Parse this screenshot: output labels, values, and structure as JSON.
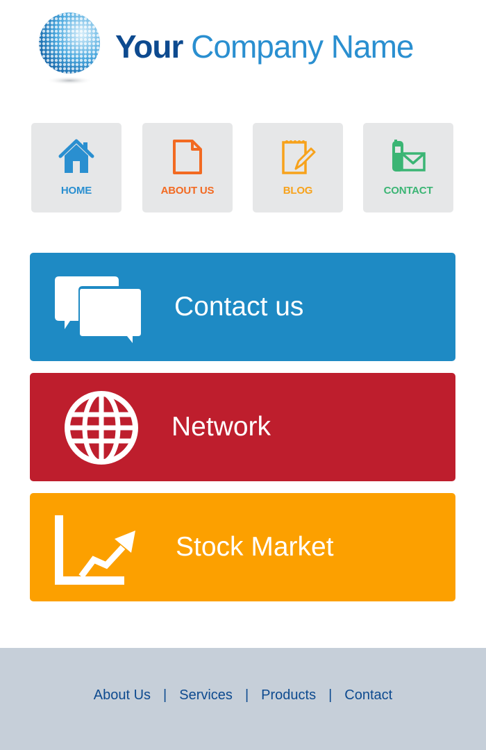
{
  "header": {
    "company_name_bold": "Your",
    "company_name_light": "Company Name"
  },
  "nav": {
    "items": [
      {
        "label": "HOME",
        "icon": "home-icon",
        "color": "#2a8fd0"
      },
      {
        "label": "ABOUT US",
        "icon": "document-icon",
        "color": "#f26a22"
      },
      {
        "label": "BLOG",
        "icon": "notepad-pencil-icon",
        "color": "#f7a21b"
      },
      {
        "label": "CONTACT",
        "icon": "phone-envelope-icon",
        "color": "#3bb574"
      }
    ]
  },
  "actions": [
    {
      "label": "Contact us",
      "icon": "chat-bubbles-icon",
      "color": "#1e8ac4"
    },
    {
      "label": "Network",
      "icon": "globe-icon",
      "color": "#be1e2d"
    },
    {
      "label": "Stock Market",
      "icon": "chart-arrow-icon",
      "color": "#fca000"
    }
  ],
  "footer": {
    "links": [
      "About Us",
      "Services",
      "Products",
      "Contact"
    ],
    "separator": "|"
  },
  "colors": {
    "tile_bg": "#e6e7e8",
    "footer_bg": "#c6cfd9",
    "brand_dark": "#0d4a8f",
    "brand_light": "#2a8fd0"
  }
}
